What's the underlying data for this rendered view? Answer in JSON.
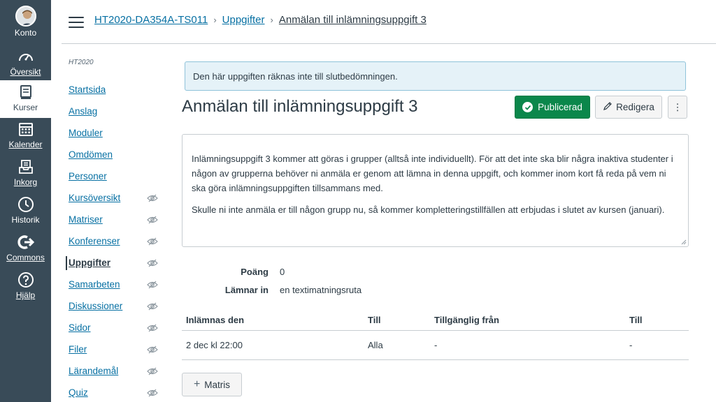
{
  "global_nav": {
    "account": "Konto",
    "dashboard": "Översikt",
    "courses": "Kurser",
    "calendar": "Kalender",
    "inbox": "Inkorg",
    "history": "Historik",
    "commons": "Commons",
    "help": "Hjälp"
  },
  "breadcrumb": {
    "course": "HT2020-DA354A-TS011",
    "section": "Uppgifter",
    "current": "Anmälan till inlämningsuppgift 3"
  },
  "course_nav": {
    "term": "HT2020",
    "items": [
      {
        "label": "Startsida",
        "hidden": false
      },
      {
        "label": "Anslag",
        "hidden": false
      },
      {
        "label": "Moduler",
        "hidden": false
      },
      {
        "label": "Omdömen",
        "hidden": false
      },
      {
        "label": "Personer",
        "hidden": false
      },
      {
        "label": "Kursöversikt",
        "hidden": true
      },
      {
        "label": "Matriser",
        "hidden": true
      },
      {
        "label": "Konferenser",
        "hidden": true
      },
      {
        "label": "Uppgifter",
        "hidden": true,
        "active": true
      },
      {
        "label": "Samarbeten",
        "hidden": true
      },
      {
        "label": "Diskussioner",
        "hidden": true
      },
      {
        "label": "Sidor",
        "hidden": true
      },
      {
        "label": "Filer",
        "hidden": true
      },
      {
        "label": "Lärandemål",
        "hidden": true
      },
      {
        "label": "Quiz",
        "hidden": true
      }
    ]
  },
  "notice": "Den här uppgiften räknas inte till slutbedömningen.",
  "assignment": {
    "title": "Anmälan till inlämningsuppgift 3",
    "published_label": "Publicerad",
    "edit_label": "Redigera",
    "more_label": "⋮",
    "description_p1": "Inlämningsuppgift 3 kommer att göras i grupper (alltså inte individuellt). För att det inte ska blir några inaktiva studenter i någon av grupperna behöver ni anmäla er genom att lämna in denna uppgift, och kommer inom kort få reda på vem ni ska göra inlämningsuppgiften tillsammans med.",
    "description_p2": "Skulle ni inte anmäla er till någon grupp nu, så kommer kompletteringstillfällen att erbjudas i slutet av kursen (januari).",
    "points_label": "Poäng",
    "points_value": "0",
    "submitting_label": "Lämnar in",
    "submitting_value": "en textimatningsruta"
  },
  "due_table": {
    "headers": [
      "Inlämnas den",
      "Till",
      "Tillgänglig från",
      "Till"
    ],
    "rows": [
      [
        "2 dec kl 22:00",
        "Alla",
        "-",
        "-"
      ]
    ]
  },
  "rubric_button": "Matris",
  "colors": {
    "nav_bg": "#394b58",
    "link": "#0770a3",
    "published": "#0b874b",
    "notice_bg": "#e5f2f8"
  }
}
